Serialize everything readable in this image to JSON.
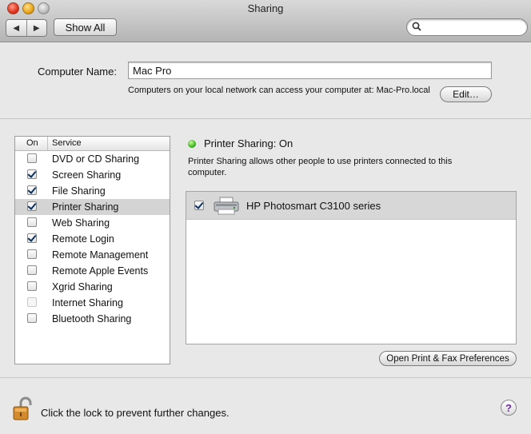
{
  "window": {
    "title": "Sharing"
  },
  "toolbar": {
    "back_icon": "back-arrow-icon",
    "forward_icon": "forward-arrow-icon",
    "show_all_label": "Show All",
    "search_placeholder": "",
    "search_icon": "magnifier-icon"
  },
  "computer": {
    "name_label": "Computer Name:",
    "name_value": "Mac Pro",
    "help_text": "Computers on your local network can access your computer at: Mac-Pro.local",
    "edit_label": "Edit…"
  },
  "service_list": {
    "col_on": "On",
    "col_service": "Service",
    "items": [
      {
        "label": "DVD or CD Sharing",
        "checked": false,
        "enabled": true,
        "selected": false
      },
      {
        "label": "Screen Sharing",
        "checked": true,
        "enabled": true,
        "selected": false
      },
      {
        "label": "File Sharing",
        "checked": true,
        "enabled": true,
        "selected": false
      },
      {
        "label": "Printer Sharing",
        "checked": true,
        "enabled": true,
        "selected": true
      },
      {
        "label": "Web Sharing",
        "checked": false,
        "enabled": true,
        "selected": false
      },
      {
        "label": "Remote Login",
        "checked": true,
        "enabled": true,
        "selected": false
      },
      {
        "label": "Remote Management",
        "checked": false,
        "enabled": true,
        "selected": false
      },
      {
        "label": "Remote Apple Events",
        "checked": false,
        "enabled": true,
        "selected": false
      },
      {
        "label": "Xgrid Sharing",
        "checked": false,
        "enabled": true,
        "selected": false
      },
      {
        "label": "Internet Sharing",
        "checked": false,
        "enabled": false,
        "selected": false
      },
      {
        "label": "Bluetooth Sharing",
        "checked": false,
        "enabled": true,
        "selected": false
      }
    ]
  },
  "detail": {
    "status_text": "Printer Sharing: On",
    "status_color": "#3cb31f",
    "description": "Printer Sharing allows other people to use printers connected to this computer.",
    "printers": [
      {
        "name": "HP Photosmart C3100 series",
        "checked": true,
        "icon": "printer-icon"
      }
    ],
    "open_prefs_label": "Open Print & Fax Preferences"
  },
  "footer": {
    "lock_icon": "open-padlock-icon",
    "lock_text": "Click the lock to prevent further changes.",
    "help_label": "?"
  }
}
